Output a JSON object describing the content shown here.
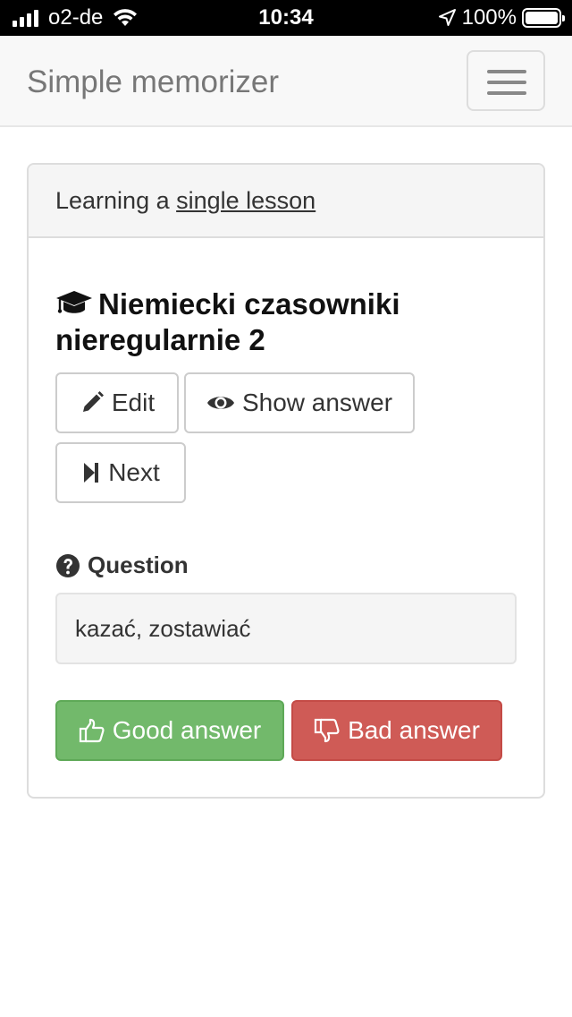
{
  "status_bar": {
    "carrier": "o2-de",
    "time": "10:34",
    "battery": "100%"
  },
  "navbar": {
    "brand": "Simple memorizer",
    "menu_icon": "hamburger-menu-icon"
  },
  "panel": {
    "heading_prefix": "Learning a ",
    "heading_link": "single lesson",
    "lesson_icon": "graduation-cap-icon",
    "lesson_title": "Niemiecki czasowniki nieregularnie 2",
    "buttons": {
      "edit": "Edit",
      "show_answer": "Show answer",
      "next": "Next"
    },
    "question_icon": "question-circle-icon",
    "question_label": "Question",
    "question_text": "kazać, zostawiać",
    "good_answer": "Good answer",
    "bad_answer": "Bad answer"
  },
  "colors": {
    "good": "#72b96b",
    "bad": "#cf5b56",
    "navbar_bg": "#f8f8f8",
    "panel_heading_bg": "#f5f5f5"
  }
}
